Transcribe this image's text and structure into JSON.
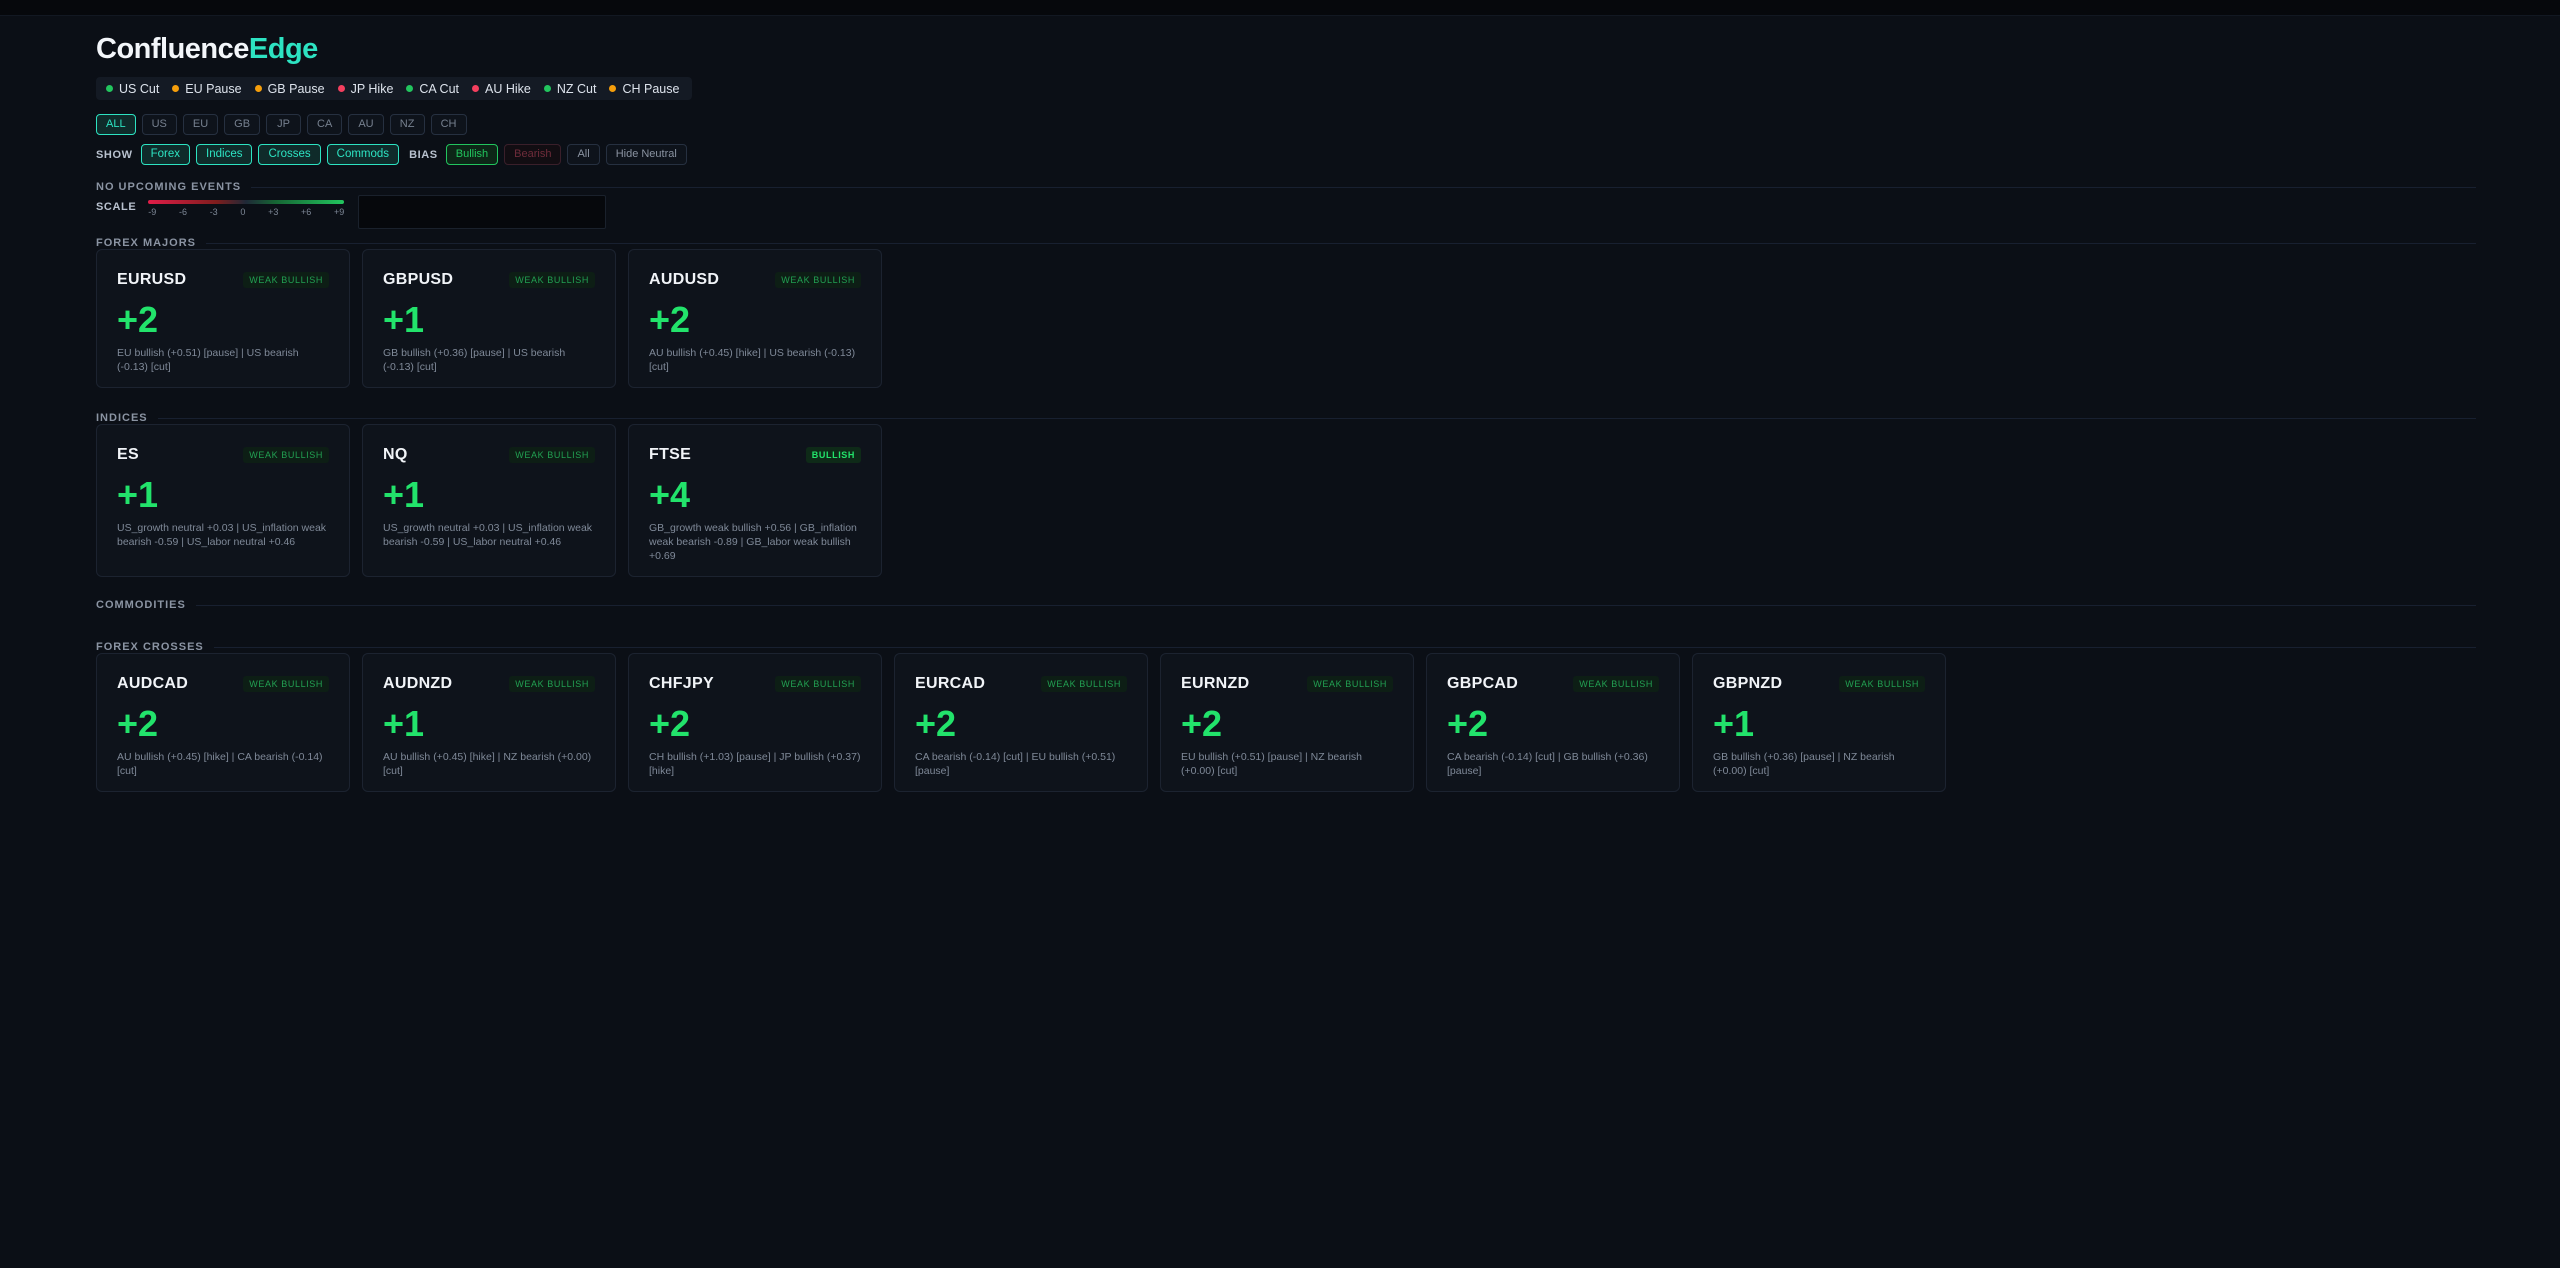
{
  "brand": {
    "part1": "Confluence",
    "part2": "Edge"
  },
  "events": [
    {
      "label": "US Cut",
      "color": "#22c55e"
    },
    {
      "label": "EU Pause",
      "color": "#f59e0b"
    },
    {
      "label": "GB Pause",
      "color": "#f59e0b"
    },
    {
      "label": "JP Hike",
      "color": "#f43f5e"
    },
    {
      "label": "CA Cut",
      "color": "#22c55e"
    },
    {
      "label": "AU Hike",
      "color": "#f43f5e"
    },
    {
      "label": "NZ Cut",
      "color": "#22c55e"
    },
    {
      "label": "CH Pause",
      "color": "#f59e0b"
    }
  ],
  "currencies": [
    "ALL",
    "US",
    "EU",
    "GB",
    "JP",
    "CA",
    "AU",
    "NZ",
    "CH"
  ],
  "show": {
    "label": "SHOW",
    "filters": [
      "Forex",
      "Indices",
      "Crosses",
      "Commods"
    ]
  },
  "bias": {
    "label": "BIAS",
    "bullish": "Bullish",
    "bearish": "Bearish",
    "all": "All",
    "hide_neutral": "Hide Neutral"
  },
  "no_events": "NO UPCOMING EVENTS",
  "scale": {
    "label": "SCALE",
    "ticks": [
      "-9",
      "-6",
      "-3",
      "0",
      "+3",
      "+6",
      "+9"
    ]
  },
  "sections": {
    "majors": "FOREX MAJORS",
    "indices": "INDICES",
    "commodities": "COMMODITIES",
    "crosses": "FOREX CROSSES"
  },
  "majors": [
    {
      "symbol": "EURUSD",
      "badge": "WEAK BULLISH",
      "score": "+2",
      "detail": "EU bullish (+0.51) [pause] | US bearish (-0.13) [cut]"
    },
    {
      "symbol": "GBPUSD",
      "badge": "WEAK BULLISH",
      "score": "+1",
      "detail": "GB bullish (+0.36) [pause] | US bearish (-0.13) [cut]"
    },
    {
      "symbol": "AUDUSD",
      "badge": "WEAK BULLISH",
      "score": "+2",
      "detail": "AU bullish (+0.45) [hike] | US bearish (-0.13) [cut]"
    }
  ],
  "indices": [
    {
      "symbol": "ES",
      "badge": "WEAK BULLISH",
      "score": "+1",
      "detail": "US_growth neutral +0.03 | US_inflation weak bearish -0.59 | US_labor neutral +0.46"
    },
    {
      "symbol": "NQ",
      "badge": "WEAK BULLISH",
      "score": "+1",
      "detail": "US_growth neutral +0.03 | US_inflation weak bearish -0.59 | US_labor neutral +0.46"
    },
    {
      "symbol": "FTSE",
      "badge": "BULLISH",
      "score": "+4",
      "detail": "GB_growth weak bullish +0.56 | GB_inflation weak bearish -0.89 | GB_labor weak bullish +0.69"
    }
  ],
  "crosses": [
    {
      "symbol": "AUDCAD",
      "badge": "WEAK BULLISH",
      "score": "+2",
      "detail": "AU bullish (+0.45) [hike] | CA bearish (-0.14) [cut]"
    },
    {
      "symbol": "AUDNZD",
      "badge": "WEAK BULLISH",
      "score": "+1",
      "detail": "AU bullish (+0.45) [hike] | NZ bearish (+0.00) [cut]"
    },
    {
      "symbol": "CHFJPY",
      "badge": "WEAK BULLISH",
      "score": "+2",
      "detail": "CH bullish (+1.03) [pause] | JP bullish (+0.37) [hike]"
    },
    {
      "symbol": "EURCAD",
      "badge": "WEAK BULLISH",
      "score": "+2",
      "detail": "CA bearish (-0.14) [cut] | EU bullish (+0.51) [pause]"
    },
    {
      "symbol": "EURNZD",
      "badge": "WEAK BULLISH",
      "score": "+2",
      "detail": "EU bullish (+0.51) [pause] | NZ bearish (+0.00) [cut]"
    },
    {
      "symbol": "GBPCAD",
      "badge": "WEAK BULLISH",
      "score": "+2",
      "detail": "CA bearish (-0.14) [cut] | GB bullish (+0.36) [pause]"
    },
    {
      "symbol": "GBPNZD",
      "badge": "WEAK BULLISH",
      "score": "+1",
      "detail": "GB bullish (+0.36) [pause] | NZ bearish (+0.00) [cut]"
    }
  ]
}
